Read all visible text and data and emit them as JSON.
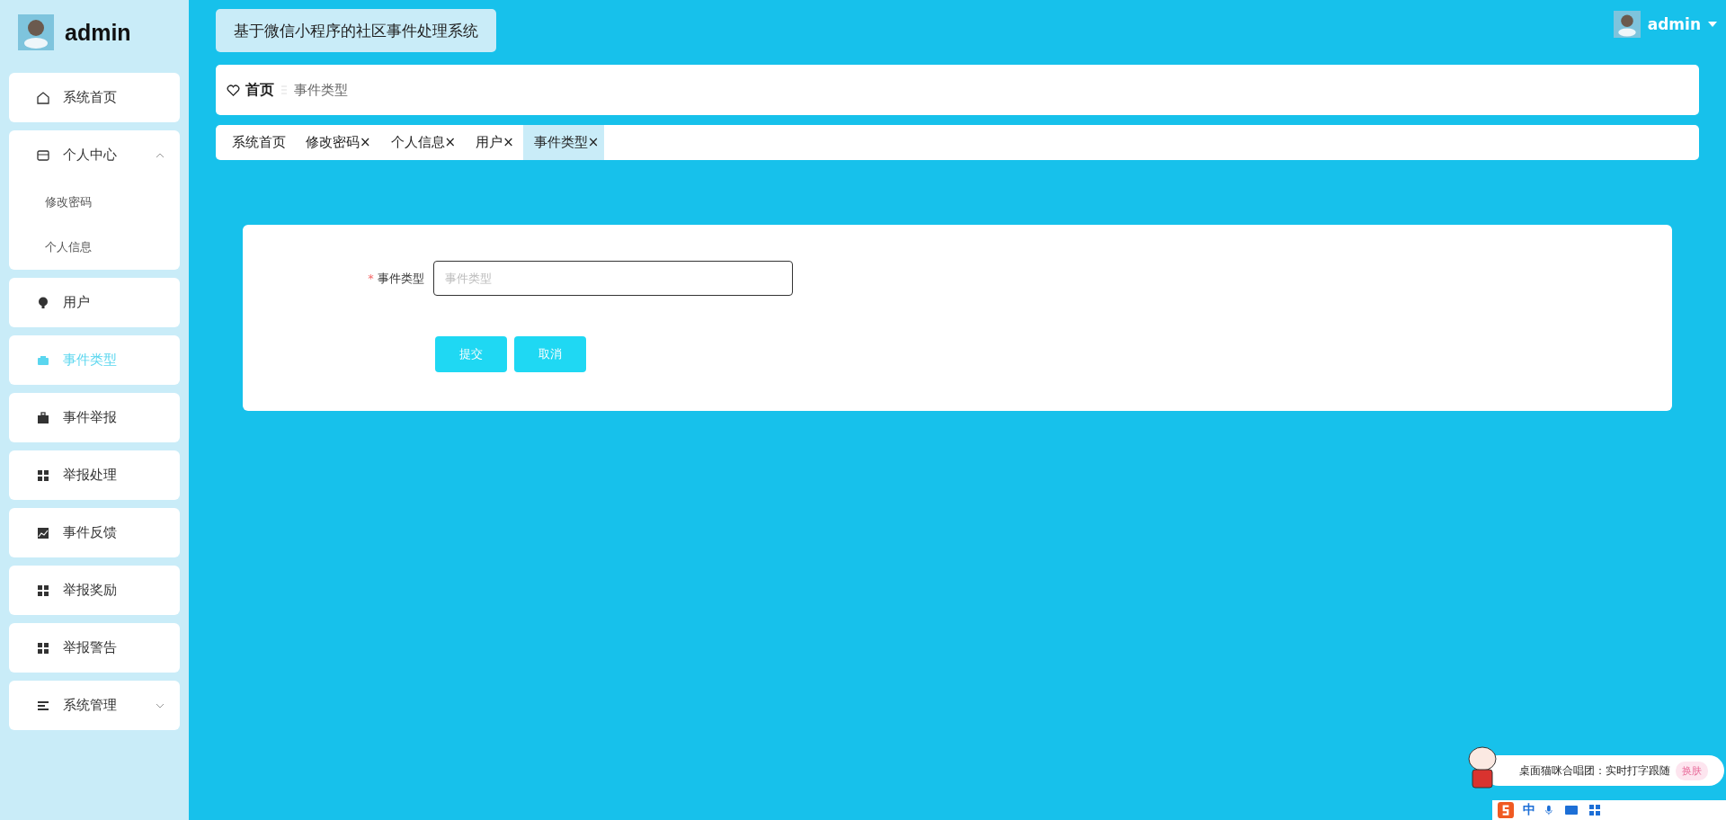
{
  "sidebar": {
    "user": "admin",
    "items": [
      {
        "label": "系统首页",
        "selected": false
      },
      {
        "label": "个人中心",
        "selected": false,
        "expanded": true,
        "children": [
          {
            "label": "修改密码",
            "selected": false
          },
          {
            "label": "个人信息",
            "selected": false
          }
        ]
      },
      {
        "label": "用户",
        "selected": false
      },
      {
        "label": "事件类型",
        "selected": true
      },
      {
        "label": "事件举报",
        "selected": false
      },
      {
        "label": "举报处理",
        "selected": false
      },
      {
        "label": "事件反馈",
        "selected": false
      },
      {
        "label": "举报奖励",
        "selected": false
      },
      {
        "label": "举报警告",
        "selected": false
      },
      {
        "label": "系统管理",
        "selected": false,
        "expanded": false
      }
    ]
  },
  "header": {
    "title": "基于微信小程序的社区事件处理系统",
    "user": "admin"
  },
  "breadcrumb": {
    "home": "首页",
    "current": "事件类型"
  },
  "tabs": [
    {
      "label": "系统首页",
      "selected": false
    },
    {
      "label": "修改密码",
      "close": "×",
      "selected": false
    },
    {
      "label": "个人信息",
      "close": "×",
      "selected": false
    },
    {
      "label": "用户",
      "close": "×",
      "selected": false
    },
    {
      "label": "事件类型",
      "close": "×",
      "selected": true
    }
  ],
  "form": {
    "required_mark": "*",
    "label": "事件类型",
    "placeholder": "事件类型",
    "buttons": [
      "提交",
      "取消"
    ]
  },
  "ime_popup": {
    "text": "桌面猫咪合唱团：实时打字跟随",
    "button": "换肤",
    "mode": "中"
  }
}
